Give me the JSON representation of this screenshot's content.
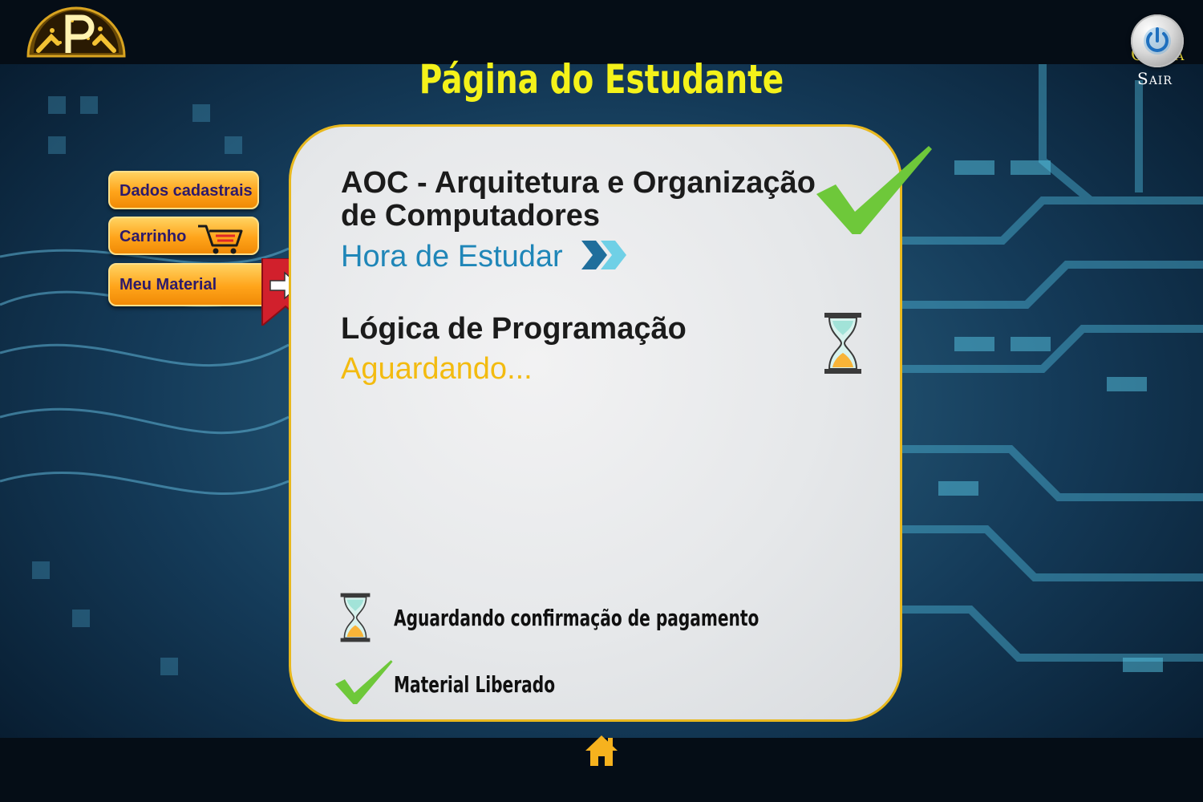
{
  "header": {
    "page_title": "Página do Estudante",
    "account_label": "Conta",
    "logout_label": "Sair"
  },
  "sidebar": {
    "items": [
      {
        "label": "Dados cadastrais"
      },
      {
        "label": "Carrinho"
      },
      {
        "label": "Meu Material"
      }
    ]
  },
  "courses": [
    {
      "title": "AOC - Arquitetura e Organização de Computadores",
      "status": "Hora de Estudar"
    },
    {
      "title": "Lógica de Programação",
      "status": "Aguardando..."
    }
  ],
  "legend": {
    "pending": "Aguardando confirmação de pagamento",
    "released": "Material Liberado"
  },
  "colors": {
    "title_yellow": "#f4f21a",
    "button_orange": "#ffa41a",
    "study_blue": "#1f86b8",
    "wait_yellow": "#f3bb10",
    "check_green": "#6ec83a",
    "card_border": "#e8b81e"
  }
}
